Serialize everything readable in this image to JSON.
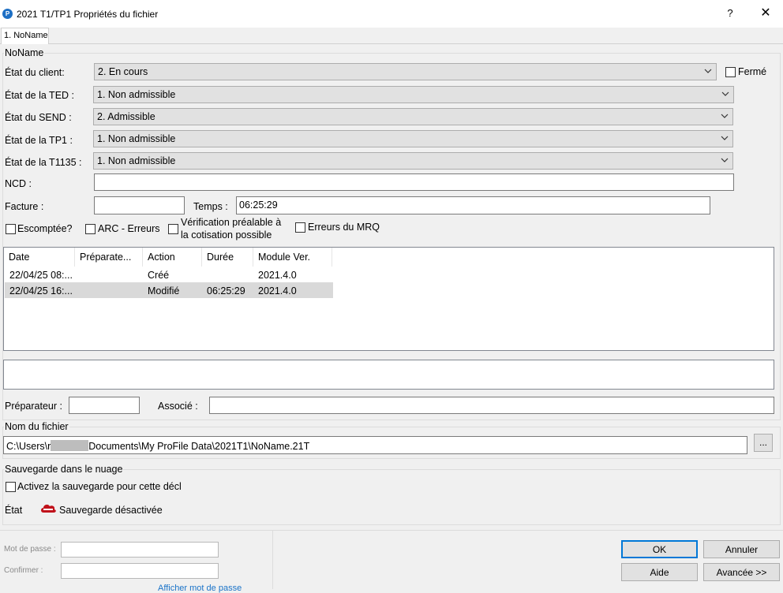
{
  "window": {
    "title": "2021 T1/TP1 Propriétés du fichier",
    "help": "?",
    "close": "✕"
  },
  "tabs": [
    {
      "label": "1. NoName"
    }
  ],
  "client_group": {
    "label": "NoName"
  },
  "fields": {
    "etat_client": {
      "label": "État du client:",
      "value": "2. En cours"
    },
    "ferme": {
      "label": "Fermé",
      "checked": false
    },
    "etat_ted": {
      "label": "État de la TED :",
      "value": "1. Non admissible"
    },
    "etat_send": {
      "label": "État du SEND :",
      "value": "2. Admissible"
    },
    "etat_tp1": {
      "label": "État de la TP1 :",
      "value": "1. Non admissible"
    },
    "etat_t1135": {
      "label": "État de la T1135 :",
      "value": "1. Non admissible"
    },
    "ncd": {
      "label": "NCD :",
      "value": ""
    },
    "facture": {
      "label": "Facture :",
      "value": ""
    },
    "temps": {
      "label": "Temps :",
      "value": "06:25:29"
    }
  },
  "checkboxes": {
    "escomptee": "Escomptée?",
    "arc_erreurs": "ARC - Erreurs",
    "verif_line1": "Vérification préalable à",
    "verif_line2": "la cotisation possible",
    "erreurs_mrq": "Erreurs du MRQ"
  },
  "history": {
    "columns": [
      "Date",
      "Préparate...",
      "Action",
      "Durée",
      "Module Ver."
    ],
    "rows": [
      [
        "22/04/25 08:...",
        "",
        "Créé",
        "",
        "2021.4.0"
      ],
      [
        "22/04/25 16:...",
        "",
        "Modifié",
        "06:25:29",
        "2021.4.0"
      ]
    ]
  },
  "preparer": {
    "label": "Préparateur :",
    "value": ""
  },
  "associe": {
    "label": "Associé :",
    "value": ""
  },
  "file_group": {
    "label": "Nom du fichier",
    "path_prefix": "C:\\Users\\r",
    "path_suffix": "Documents\\My ProFile Data\\2021T1\\NoName.21T",
    "browse": "..."
  },
  "cloud_group": {
    "label": "Sauvegarde dans le nuage",
    "enable_label": "Activez la sauvegarde pour cette décl",
    "state_label": "État",
    "state_value": "Sauvegarde désactivée",
    "state_color": "#c0121b"
  },
  "password": {
    "mot_de_passe": "Mot de passe :",
    "confirmer": "Confirmer :",
    "show_link": "Afficher mot de passe"
  },
  "buttons": {
    "ok": "OK",
    "annuler": "Annuler",
    "aide": "Aide",
    "avancee": "Avancée >>"
  }
}
